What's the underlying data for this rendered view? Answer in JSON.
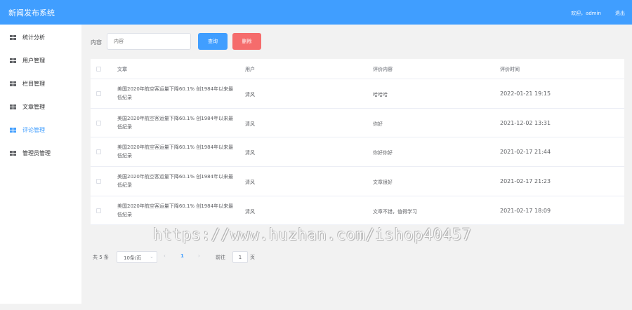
{
  "header": {
    "title": "新闻发布系统",
    "welcome": "欢迎，admin",
    "logout": "退出"
  },
  "colors": {
    "primary": "#409eff",
    "danger": "#f56c6c",
    "background": "#f2f2f2"
  },
  "sidebar": {
    "items": [
      {
        "label": "统计分析",
        "icon": "grid-icon",
        "active": false
      },
      {
        "label": "用户管理",
        "icon": "grid-icon",
        "active": false
      },
      {
        "label": "栏目管理",
        "icon": "grid-icon",
        "active": false
      },
      {
        "label": "文章管理",
        "icon": "grid-icon",
        "active": false
      },
      {
        "label": "评论管理",
        "icon": "grid-icon",
        "active": true
      },
      {
        "label": "管理员管理",
        "icon": "grid-icon",
        "active": false
      }
    ]
  },
  "search": {
    "label": "内容",
    "placeholder": "内容",
    "query_label": "查询",
    "delete_label": "删除"
  },
  "table": {
    "headers": [
      "文章",
      "用户",
      "评价内容",
      "评价时间"
    ],
    "rows": [
      {
        "article": "美国2020年航空客运量下降60.1% 创1984年以来最低纪录",
        "user": "清风",
        "content": "哈哈哈",
        "time": "2022-01-21 19:15"
      },
      {
        "article": "美国2020年航空客运量下降60.1% 创1984年以来最低纪录",
        "user": "清风",
        "content": "你好",
        "time": "2021-12-02 13:31"
      },
      {
        "article": "美国2020年航空客运量下降60.1% 创1984年以来最低纪录",
        "user": "清风",
        "content": "你好你好",
        "time": "2021-02-17 21:44"
      },
      {
        "article": "美国2020年航空客运量下降60.1% 创1984年以来最低纪录",
        "user": "清风",
        "content": "文章很好",
        "time": "2021-02-17 21:23"
      },
      {
        "article": "美国2020年航空客运量下降60.1% 创1984年以来最低纪录",
        "user": "清风",
        "content": "文章不错，值得学习",
        "time": "2021-02-17 18:09"
      }
    ]
  },
  "pagination": {
    "total": "共 5 条",
    "page_size": "10条/页",
    "current_page": "1",
    "goto_label": "前往",
    "goto_value": "1",
    "page_unit": "页"
  },
  "watermark": "https://www.huzhan.com/ishop40457"
}
